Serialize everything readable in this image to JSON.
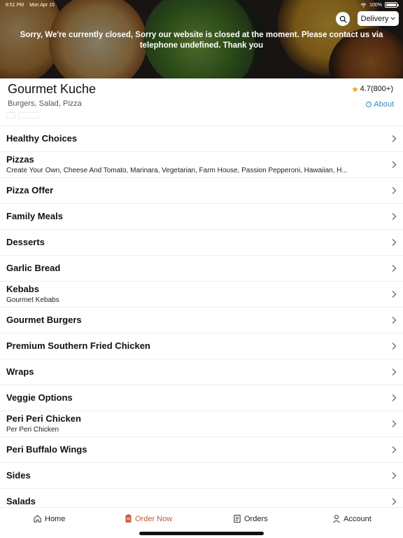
{
  "status_bar": {
    "time": "8:51 PM",
    "date": "Mon Apr 15",
    "battery": "100%",
    "battery_level": 1.0
  },
  "hero": {
    "closed_message": "Sorry, We're currently closed, Sorry our website is closed at the moment. Please contact us via telephone undefined. Thank you",
    "delivery_label": "Delivery"
  },
  "restaurant": {
    "name": "Gourmet Kuche",
    "cuisines": "Burgers, Salad, Pizza",
    "rating": "4.7(800+)",
    "about_label": "About"
  },
  "categories": [
    {
      "title": "Healthy Choices",
      "subtitle": ""
    },
    {
      "title": "Pizzas",
      "subtitle": "Create Your Own, Cheese And Tomato, Marinara, Vegetarian, Farm House, Passion Pepperoni, Hawaiian, H..."
    },
    {
      "title": "Pizza Offer",
      "subtitle": ""
    },
    {
      "title": "Family Meals",
      "subtitle": ""
    },
    {
      "title": "Desserts",
      "subtitle": ""
    },
    {
      "title": "Garlic Bread",
      "subtitle": ""
    },
    {
      "title": "Kebabs",
      "subtitle": "Gourmet Kebabs"
    },
    {
      "title": "Gourmet Burgers",
      "subtitle": ""
    },
    {
      "title": "Premium Southern Fried Chicken",
      "subtitle": ""
    },
    {
      "title": "Wraps",
      "subtitle": ""
    },
    {
      "title": "Veggie Options",
      "subtitle": ""
    },
    {
      "title": "Peri Peri Chicken",
      "subtitle": "Per Peri Chicken"
    },
    {
      "title": "Peri Buffalo Wings",
      "subtitle": ""
    },
    {
      "title": "Sides",
      "subtitle": ""
    },
    {
      "title": "Salads",
      "subtitle": ""
    }
  ],
  "bottom_nav": [
    {
      "label": "Home",
      "icon": "home-icon",
      "active": false
    },
    {
      "label": "Order Now",
      "icon": "order-icon",
      "active": true
    },
    {
      "label": "Orders",
      "icon": "receipt-icon",
      "active": false
    },
    {
      "label": "Account",
      "icon": "person-icon",
      "active": false
    }
  ],
  "colors": {
    "accent": "#c65c3d",
    "link": "#2b8cc4",
    "star": "#f5a623"
  }
}
